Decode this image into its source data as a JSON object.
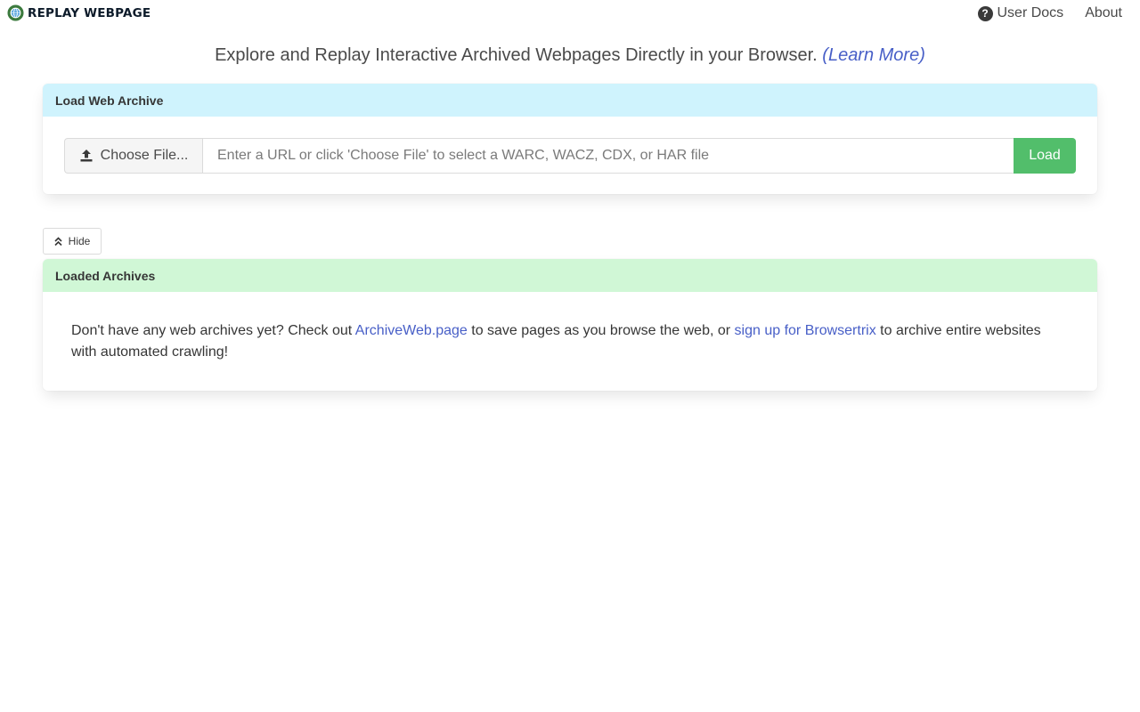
{
  "nav": {
    "brand": "REPLAY WEBPAGE",
    "brand_logo_icon": "globe-logo-icon",
    "user_docs": "User Docs",
    "about": "About"
  },
  "headline": {
    "text": "Explore and Replay Interactive Archived Webpages Directly in your Browser.",
    "learn_more": "(Learn More)"
  },
  "load_card": {
    "title": "Load Web Archive",
    "choose_file": "Choose File...",
    "url_placeholder": "Enter a URL or click 'Choose File' to select a WARC, WACZ, CDX, or HAR file",
    "url_value": "",
    "load_button": "Load"
  },
  "hide_button": "Hide",
  "loaded_card": {
    "title": "Loaded Archives",
    "text_1": "Don't have any web archives yet? Check out ",
    "link_1": "ArchiveWeb.page",
    "text_2": " to save pages as you browse the web, or ",
    "link_2": "sign up for Browsertrix",
    "text_3": " to archive entire websites with automated crawling!"
  },
  "colors": {
    "load_header_bg": "#cff3fd",
    "loaded_header_bg": "#d0f7d6",
    "load_button_bg": "#52be6b",
    "link": "#485fc7"
  }
}
